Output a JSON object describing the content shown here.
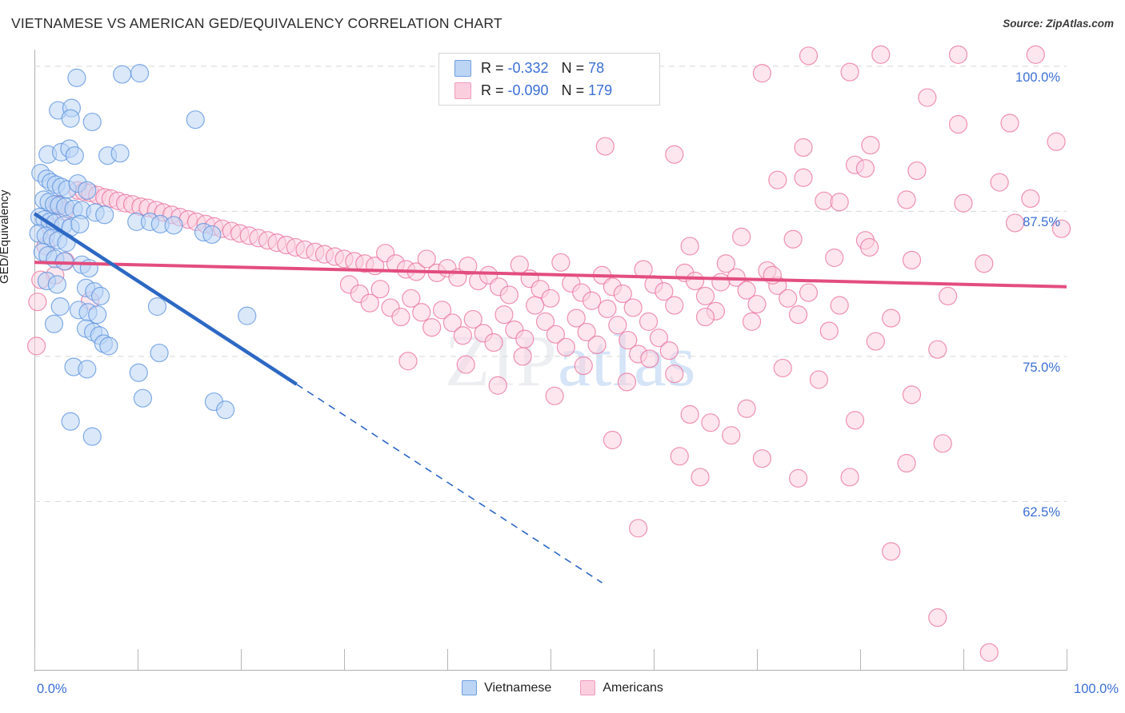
{
  "header": {
    "title": "VIETNAMESE VS AMERICAN GED/EQUIVALENCY CORRELATION CHART",
    "source": "Source: ZipAtlas.com"
  },
  "watermark": {
    "part1": "ZIP",
    "part2": "atlas"
  },
  "stats": {
    "rows": [
      {
        "series": "Vietnamese",
        "r_label": "R = ",
        "r_value": "-0.332",
        "n_label": "N = ",
        "n_value": "78",
        "color": "#bcd5f5"
      },
      {
        "series": "Americans",
        "r_label": "R = ",
        "r_value": "-0.090",
        "n_label": "N = ",
        "n_value": "179",
        "color": "#fbcede"
      }
    ]
  },
  "legend": {
    "items": [
      {
        "label": "Vietnamese",
        "color": "#bcd5f5",
        "border": "#6f9fe0"
      },
      {
        "label": "Americans",
        "color": "#fbcede",
        "border": "#ef9cbd"
      }
    ]
  },
  "axes": {
    "y_title": "GED/Equivalency",
    "y_ticks": [
      "100.0%",
      "87.5%",
      "75.0%",
      "62.5%"
    ],
    "x_min_label": "0.0%",
    "x_max_label": "100.0%"
  },
  "chart_data": {
    "type": "scatter",
    "title": "VIETNAMESE VS AMERICAN GED/EQUIVALENCY CORRELATION CHART",
    "xlabel": "",
    "ylabel": "GED/Equivalency",
    "xlim": [
      0,
      100
    ],
    "ylim": [
      48.0,
      101.3
    ],
    "x_ticks": [
      0,
      10,
      20,
      30,
      40,
      50,
      60,
      70,
      80,
      90,
      100
    ],
    "y_ticks": [
      62.5,
      75.0,
      87.5,
      100.0
    ],
    "grid": "horizontal-dashed",
    "legend_position": "bottom-center",
    "colors": {
      "vietnamese_fill": "#bcd5f5",
      "vietnamese_stroke": "#5b92dd",
      "americans_fill": "#fbd2e0",
      "americans_stroke": "#ea6f9c",
      "trend_blue": "#2d68c4",
      "trend_pink": "#e34d7f",
      "tick_label": "#3b6fd4"
    },
    "series": [
      {
        "name": "Vietnamese",
        "r": -0.332,
        "n": 78,
        "fill": "#bcd5f5",
        "stroke": "#5b92dd",
        "trend": {
          "color": "#2d68c4",
          "solid_from": [
            0.0,
            87.3
          ],
          "solid_to": [
            25.4,
            72.6
          ],
          "dashed_to": [
            55.0,
            55.5
          ]
        },
        "points": [
          [
            4.1,
            99.0
          ],
          [
            8.5,
            99.3
          ],
          [
            10.2,
            99.4
          ],
          [
            2.3,
            96.2
          ],
          [
            3.6,
            96.4
          ],
          [
            3.5,
            95.5
          ],
          [
            5.6,
            95.2
          ],
          [
            15.6,
            95.4
          ],
          [
            1.3,
            92.4
          ],
          [
            2.6,
            92.6
          ],
          [
            3.4,
            92.9
          ],
          [
            3.9,
            92.3
          ],
          [
            7.1,
            92.3
          ],
          [
            8.3,
            92.5
          ],
          [
            0.6,
            90.8
          ],
          [
            1.2,
            90.3
          ],
          [
            1.6,
            90.0
          ],
          [
            2.1,
            89.8
          ],
          [
            2.6,
            89.6
          ],
          [
            3.2,
            89.4
          ],
          [
            4.2,
            89.9
          ],
          [
            5.1,
            89.3
          ],
          [
            0.9,
            88.5
          ],
          [
            1.4,
            88.3
          ],
          [
            1.9,
            88.1
          ],
          [
            2.4,
            88.0
          ],
          [
            3.0,
            87.9
          ],
          [
            3.8,
            87.7
          ],
          [
            4.6,
            87.6
          ],
          [
            5.9,
            87.4
          ],
          [
            6.8,
            87.2
          ],
          [
            0.5,
            87.0
          ],
          [
            1.0,
            86.8
          ],
          [
            1.5,
            86.6
          ],
          [
            2.0,
            86.5
          ],
          [
            2.8,
            86.3
          ],
          [
            3.5,
            86.1
          ],
          [
            4.4,
            86.4
          ],
          [
            0.4,
            85.6
          ],
          [
            1.1,
            85.4
          ],
          [
            1.7,
            85.2
          ],
          [
            2.3,
            85.0
          ],
          [
            3.1,
            84.8
          ],
          [
            9.9,
            86.6
          ],
          [
            11.2,
            86.6
          ],
          [
            12.2,
            86.4
          ],
          [
            13.5,
            86.3
          ],
          [
            16.4,
            85.7
          ],
          [
            17.2,
            85.5
          ],
          [
            0.8,
            84.0
          ],
          [
            1.3,
            83.7
          ],
          [
            2.0,
            83.4
          ],
          [
            2.9,
            83.2
          ],
          [
            4.6,
            82.9
          ],
          [
            5.3,
            82.6
          ],
          [
            1.2,
            81.5
          ],
          [
            2.2,
            81.2
          ],
          [
            5.0,
            80.9
          ],
          [
            5.8,
            80.6
          ],
          [
            6.4,
            80.2
          ],
          [
            2.5,
            79.3
          ],
          [
            4.3,
            79.0
          ],
          [
            5.2,
            78.8
          ],
          [
            6.1,
            78.6
          ],
          [
            11.9,
            79.3
          ],
          [
            1.9,
            77.8
          ],
          [
            5.0,
            77.4
          ],
          [
            5.7,
            77.1
          ],
          [
            6.3,
            76.8
          ],
          [
            20.6,
            78.5
          ],
          [
            6.7,
            76.1
          ],
          [
            7.2,
            75.9
          ],
          [
            12.1,
            75.3
          ],
          [
            3.8,
            74.1
          ],
          [
            5.1,
            73.9
          ],
          [
            10.1,
            73.6
          ],
          [
            10.5,
            71.4
          ],
          [
            17.4,
            71.1
          ],
          [
            18.5,
            70.4
          ],
          [
            3.5,
            69.4
          ],
          [
            5.6,
            68.1
          ]
        ]
      },
      {
        "name": "Americans",
        "r": -0.09,
        "n": 179,
        "fill": "#fbd2e0",
        "stroke": "#ea6f9c",
        "trend": {
          "color": "#e34d7f",
          "from": [
            0.0,
            83.1
          ],
          "to": [
            100.0,
            81.0
          ]
        },
        "points": [
          [
            4.2,
            89.3
          ],
          [
            4.8,
            89.2
          ],
          [
            5.4,
            89.1
          ],
          [
            6.1,
            88.9
          ],
          [
            6.8,
            88.7
          ],
          [
            7.4,
            88.6
          ],
          [
            8.1,
            88.4
          ],
          [
            8.8,
            88.2
          ],
          [
            9.5,
            88.1
          ],
          [
            10.3,
            87.9
          ],
          [
            11.0,
            87.8
          ],
          [
            11.8,
            87.6
          ],
          [
            12.5,
            87.4
          ],
          [
            13.3,
            87.2
          ],
          [
            14.1,
            87.0
          ],
          [
            14.9,
            86.8
          ],
          [
            15.7,
            86.6
          ],
          [
            16.6,
            86.4
          ],
          [
            17.4,
            86.2
          ],
          [
            18.2,
            86.0
          ],
          [
            19.1,
            85.8
          ],
          [
            19.9,
            85.6
          ],
          [
            20.8,
            85.4
          ],
          [
            21.7,
            85.2
          ],
          [
            22.6,
            85.0
          ],
          [
            23.5,
            84.8
          ],
          [
            24.4,
            84.6
          ],
          [
            25.3,
            84.4
          ],
          [
            26.2,
            84.2
          ],
          [
            27.2,
            84.0
          ],
          [
            28.1,
            83.8
          ],
          [
            29.1,
            83.6
          ],
          [
            30.0,
            83.4
          ],
          [
            31.0,
            83.2
          ],
          [
            32.0,
            83.0
          ],
          [
            33.0,
            82.8
          ],
          [
            2.2,
            88.1
          ],
          [
            2.9,
            87.5
          ],
          [
            1.5,
            86.2
          ],
          [
            1.1,
            84.5
          ],
          [
            3.0,
            83.2
          ],
          [
            2.0,
            82.0
          ],
          [
            0.6,
            81.6
          ],
          [
            0.3,
            79.7
          ],
          [
            0.2,
            75.9
          ],
          [
            5.4,
            79.8
          ],
          [
            34.0,
            83.9
          ],
          [
            35.0,
            83.0
          ],
          [
            36.0,
            82.5
          ],
          [
            37.0,
            82.3
          ],
          [
            38.0,
            83.4
          ],
          [
            39.0,
            82.2
          ],
          [
            40.0,
            82.6
          ],
          [
            41.0,
            81.8
          ],
          [
            42.0,
            82.8
          ],
          [
            43.0,
            81.5
          ],
          [
            44.0,
            82.0
          ],
          [
            45.0,
            81.0
          ],
          [
            46.0,
            80.3
          ],
          [
            47.0,
            82.9
          ],
          [
            48.0,
            81.7
          ],
          [
            49.0,
            80.8
          ],
          [
            50.0,
            80.0
          ],
          [
            51.0,
            83.1
          ],
          [
            52.0,
            81.3
          ],
          [
            53.0,
            80.5
          ],
          [
            54.0,
            79.8
          ],
          [
            55.0,
            82.0
          ],
          [
            56.0,
            81.0
          ],
          [
            57.0,
            80.4
          ],
          [
            58.0,
            79.2
          ],
          [
            59.0,
            82.5
          ],
          [
            60.0,
            81.2
          ],
          [
            61.0,
            80.6
          ],
          [
            62.0,
            79.4
          ],
          [
            63.0,
            82.2
          ],
          [
            64.0,
            81.5
          ],
          [
            65.0,
            80.2
          ],
          [
            66.0,
            78.9
          ],
          [
            67.0,
            83.0
          ],
          [
            68.0,
            81.8
          ],
          [
            69.0,
            80.7
          ],
          [
            70.0,
            79.5
          ],
          [
            71.0,
            82.4
          ],
          [
            72.0,
            81.1
          ],
          [
            73.0,
            80.0
          ],
          [
            74.0,
            78.6
          ],
          [
            30.5,
            81.2
          ],
          [
            31.5,
            80.4
          ],
          [
            32.5,
            79.6
          ],
          [
            33.5,
            80.8
          ],
          [
            34.5,
            79.2
          ],
          [
            35.5,
            78.4
          ],
          [
            36.5,
            80.0
          ],
          [
            37.5,
            78.8
          ],
          [
            38.5,
            77.5
          ],
          [
            39.5,
            79.0
          ],
          [
            40.5,
            77.9
          ],
          [
            41.5,
            76.8
          ],
          [
            42.5,
            78.2
          ],
          [
            43.5,
            77.0
          ],
          [
            44.5,
            76.2
          ],
          [
            45.5,
            78.6
          ],
          [
            46.5,
            77.3
          ],
          [
            47.5,
            76.5
          ],
          [
            48.5,
            79.4
          ],
          [
            49.5,
            78.0
          ],
          [
            50.5,
            76.9
          ],
          [
            51.5,
            75.8
          ],
          [
            52.5,
            78.3
          ],
          [
            53.5,
            77.1
          ],
          [
            54.5,
            76.0
          ],
          [
            55.5,
            79.1
          ],
          [
            56.5,
            77.7
          ],
          [
            57.5,
            76.4
          ],
          [
            58.5,
            75.2
          ],
          [
            59.5,
            78.0
          ],
          [
            60.5,
            76.6
          ],
          [
            61.5,
            75.5
          ],
          [
            36.2,
            74.6
          ],
          [
            41.8,
            74.3
          ],
          [
            47.3,
            75.0
          ],
          [
            53.2,
            74.2
          ],
          [
            59.6,
            74.8
          ],
          [
            44.9,
            72.5
          ],
          [
            50.4,
            71.6
          ],
          [
            57.4,
            72.8
          ],
          [
            62.0,
            73.5
          ],
          [
            63.5,
            70.0
          ],
          [
            65.5,
            69.3
          ],
          [
            67.5,
            68.2
          ],
          [
            69.0,
            70.5
          ],
          [
            56.0,
            67.8
          ],
          [
            62.5,
            66.4
          ],
          [
            64.5,
            64.6
          ],
          [
            70.5,
            66.2
          ],
          [
            58.5,
            60.2
          ],
          [
            75.0,
            100.9
          ],
          [
            82.0,
            101.0
          ],
          [
            89.5,
            101.0
          ],
          [
            97.0,
            101.0
          ],
          [
            70.5,
            99.4
          ],
          [
            79.0,
            99.5
          ],
          [
            86.5,
            97.3
          ],
          [
            89.5,
            95.0
          ],
          [
            94.5,
            95.1
          ],
          [
            55.3,
            93.1
          ],
          [
            62.0,
            92.4
          ],
          [
            74.5,
            93.0
          ],
          [
            81.0,
            93.2
          ],
          [
            99.0,
            93.5
          ],
          [
            72.0,
            90.2
          ],
          [
            74.5,
            90.4
          ],
          [
            79.5,
            91.5
          ],
          [
            80.5,
            91.2
          ],
          [
            85.5,
            91.0
          ],
          [
            93.5,
            90.0
          ],
          [
            76.5,
            88.4
          ],
          [
            78.0,
            88.3
          ],
          [
            84.5,
            88.5
          ],
          [
            90.0,
            88.2
          ],
          [
            96.5,
            88.6
          ],
          [
            95.0,
            86.5
          ],
          [
            99.5,
            86.0
          ],
          [
            80.5,
            85.0
          ],
          [
            80.9,
            84.4
          ],
          [
            73.5,
            85.1
          ],
          [
            63.5,
            84.5
          ],
          [
            68.5,
            85.3
          ],
          [
            77.5,
            83.5
          ],
          [
            85.0,
            83.3
          ],
          [
            92.0,
            83.0
          ],
          [
            71.5,
            82.0
          ],
          [
            66.5,
            81.4
          ],
          [
            75.0,
            80.5
          ],
          [
            88.5,
            80.2
          ],
          [
            78.0,
            79.4
          ],
          [
            65.0,
            78.4
          ],
          [
            69.5,
            78.0
          ],
          [
            83.0,
            78.3
          ],
          [
            77.0,
            77.2
          ],
          [
            81.5,
            76.3
          ],
          [
            87.5,
            75.6
          ],
          [
            72.5,
            74.0
          ],
          [
            76.0,
            73.0
          ],
          [
            85.0,
            71.7
          ],
          [
            79.5,
            69.5
          ],
          [
            88.0,
            67.5
          ],
          [
            84.5,
            65.8
          ],
          [
            74.0,
            64.5
          ],
          [
            79.0,
            64.6
          ],
          [
            83.0,
            58.2
          ],
          [
            87.5,
            52.5
          ],
          [
            92.5,
            49.5
          ]
        ]
      }
    ]
  }
}
